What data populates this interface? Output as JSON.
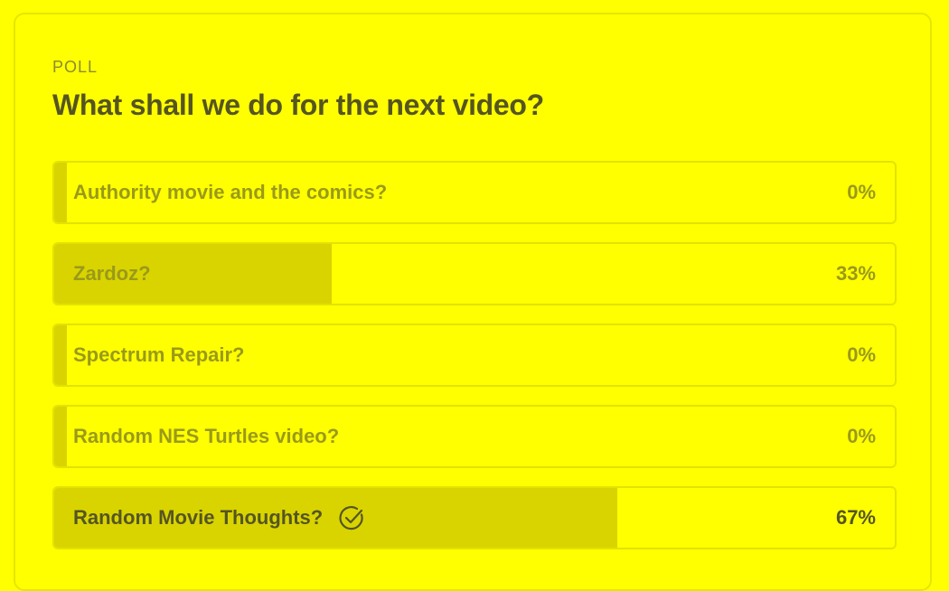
{
  "poll": {
    "label": "POLL",
    "title": "What shall we do for the next video?",
    "options": [
      {
        "label": "Authority movie and the comics?",
        "percent_text": "0%",
        "percent": 0,
        "selected": false
      },
      {
        "label": "Zardoz?",
        "percent_text": "33%",
        "percent": 33,
        "selected": false
      },
      {
        "label": "Spectrum Repair?",
        "percent_text": "0%",
        "percent": 0,
        "selected": false
      },
      {
        "label": "Random NES Turtles video?",
        "percent_text": "0%",
        "percent": 0,
        "selected": false
      },
      {
        "label": "Random Movie Thoughts?",
        "percent_text": "67%",
        "percent": 67,
        "selected": true,
        "icon": "check-circle-icon"
      }
    ]
  },
  "colors": {
    "background": "#ffff00",
    "bar_fill": "#d9d400",
    "text_muted": "#9a9a1a",
    "text_strong": "#555522"
  }
}
